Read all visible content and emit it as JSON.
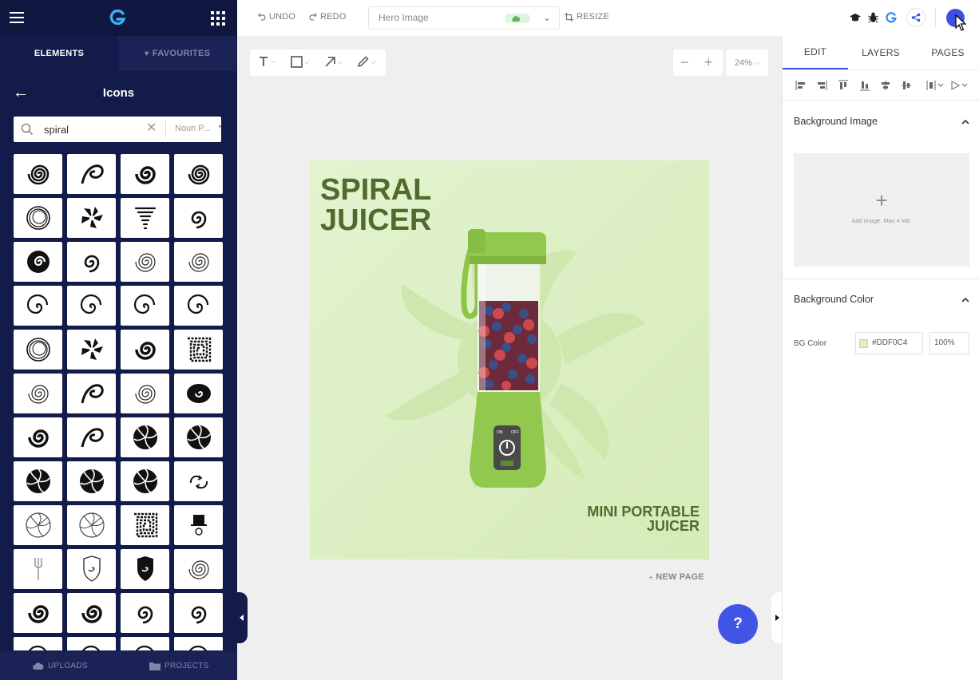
{
  "left_panel": {
    "tabs": {
      "elements": "ELEMENTS",
      "favourites": "FAVOURITES"
    },
    "section_title": "Icons",
    "search": {
      "value": "spiral",
      "source": "Noun P..."
    },
    "icons": [
      "spiral-icon",
      "swirl-arrow-icon",
      "spiral-bowl-icon",
      "spiral-small-icon",
      "concentric-spiral-icon",
      "spiky-swirl-icon",
      "tornado-icon",
      "spiral-open-icon",
      "spiral-filled-icon",
      "spiral-loop-icon",
      "spiral-thin-icon",
      "spiral-thin-icon",
      "spiral-arc-icon",
      "spiral-arc-icon",
      "spiral-arc-icon",
      "spiral-hook-icon",
      "circle-rings-icon",
      "pinwheel-icon",
      "spiral-bold-icon",
      "square-spiral-icon",
      "spiral-thin-icon",
      "swirl-bold-icon",
      "spiral-thin-icon",
      "spiral-blob-icon",
      "spiral-bold-icon",
      "nautilus-icon",
      "pinwheel-filled-icon",
      "pinwheel-filled-icon",
      "pinwheel-filled-icon",
      "pinwheel-filled-icon",
      "pinwheel-filled-icon",
      "recycle-arrows-icon",
      "pinwheel-outline-icon",
      "pinwheel-outline-icon",
      "square-spiral-arrow-icon",
      "magician-hat-icon",
      "fork-icon",
      "shield-spiral-icon",
      "shield-spiral-filled-icon",
      "spiral-thin-icon",
      "spiral-bold-icon",
      "spiral-bold-icon",
      "spiral-open-icon",
      "spiral-open-icon",
      "spiral-arc-icon",
      "spiral-arc-icon",
      "spiral-arc-icon",
      "spiral-arc-icon"
    ],
    "bottom": {
      "uploads": "UPLOADS",
      "projects": "PROJECTS"
    }
  },
  "topbar": {
    "undo": "UNDO",
    "redo": "REDO",
    "doc_name": "Hero Image",
    "resize": "RESIZE"
  },
  "canvas": {
    "zoom": "24%",
    "title": "SPIRAL JUICER",
    "subtitle": "MINI PORTABLE JUICER",
    "juicer_labels": {
      "on": "ON",
      "off": "OFF"
    },
    "background_color": "#DDF0C4",
    "new_page": "NEW PAGE",
    "help": "?"
  },
  "right_panel": {
    "tabs": {
      "edit": "EDIT",
      "layers": "LAYERS",
      "pages": "PAGES"
    },
    "background_image": {
      "title": "Background Image",
      "hint": "Add image. Max 4 Mb."
    },
    "background_color": {
      "title": "Background Color",
      "label": "BG Color",
      "value": "#DDF0C4",
      "opacity": "100%"
    }
  },
  "colors": {
    "sidebar": "#131B4A",
    "accent": "#3D4FE0",
    "canvas_bg": "#DDF0C4",
    "title_green": "#4F6B2D"
  }
}
